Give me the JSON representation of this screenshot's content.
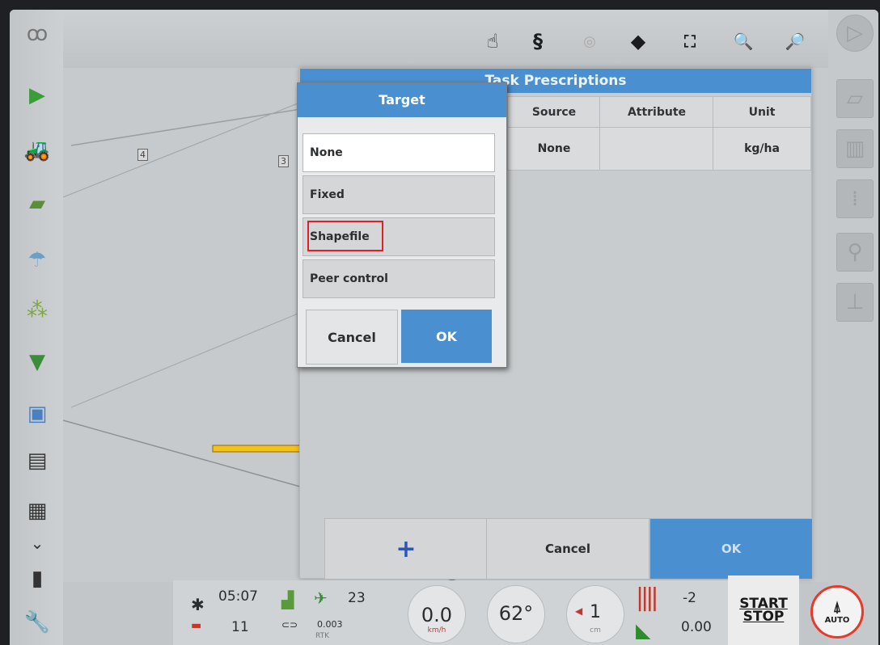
{
  "dialog": {
    "title": "Target",
    "options": [
      "None",
      "Fixed",
      "Shapefile",
      "Peer control"
    ],
    "selected_option": "None",
    "cancel_label": "Cancel",
    "ok_label": "OK"
  },
  "panel": {
    "title": "Task Prescriptions",
    "columns": [
      "Source",
      "Attribute",
      "Unit"
    ],
    "row": {
      "source": "None",
      "attribute": "",
      "unit": "kg/ha"
    },
    "add_label": "+",
    "cancel_label": "Cancel",
    "ok_label": "OK"
  },
  "map": {
    "lane_labels": [
      "4",
      "3"
    ]
  },
  "status": {
    "time": "05:07",
    "date": "11",
    "satellites": "23",
    "accuracy": "0.003",
    "rtk": "RTK",
    "speed": "0.0",
    "speed_unit": "km/h",
    "heading": "62°",
    "offset": "1",
    "offset_unit": "cm",
    "section_top": "-2",
    "section_bottom": "0.00"
  },
  "controls": {
    "start": "START",
    "stop": "STOP",
    "auto": "AUTO"
  },
  "colors": {
    "accent": "#4a8fd0",
    "highlight": "#e21f26"
  }
}
